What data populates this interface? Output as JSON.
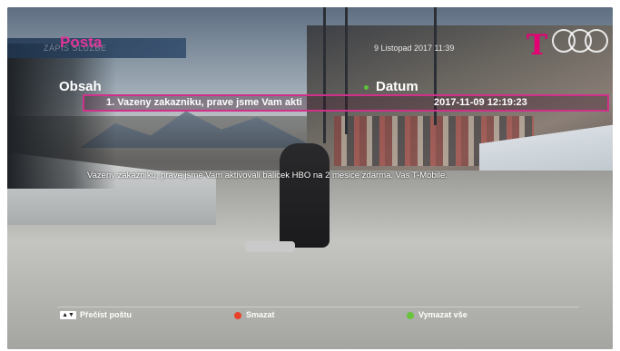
{
  "header": {
    "title": "Posta",
    "subtitle_faded": "ZÁPIS SLUŽBE",
    "date": "9 Listopad 2017 11:39",
    "logo": "T"
  },
  "columns": {
    "content_label": "Obsah",
    "date_label": "Datum"
  },
  "messages": [
    {
      "subject": "1. Vazeny zakazniku, prave jsme Vam akti",
      "date": "2017-11-09 12:19:23",
      "selected": true
    }
  ],
  "message_body": "Vazeny zakazniku, prave jsme Vam aktivovali balicek HBO na 2 mesice zdarma. Vas T-Mobile.",
  "footer": {
    "read_label": "Přečíst poštu",
    "read_icon": "up-down-arrows-icon",
    "delete_label": "Smazat",
    "delete_color": "#e8432a",
    "delete_all_label": "Vymazat vše",
    "delete_all_color": "#6ac43b"
  },
  "colors": {
    "accent": "#e0369a",
    "brand": "#e20074"
  }
}
